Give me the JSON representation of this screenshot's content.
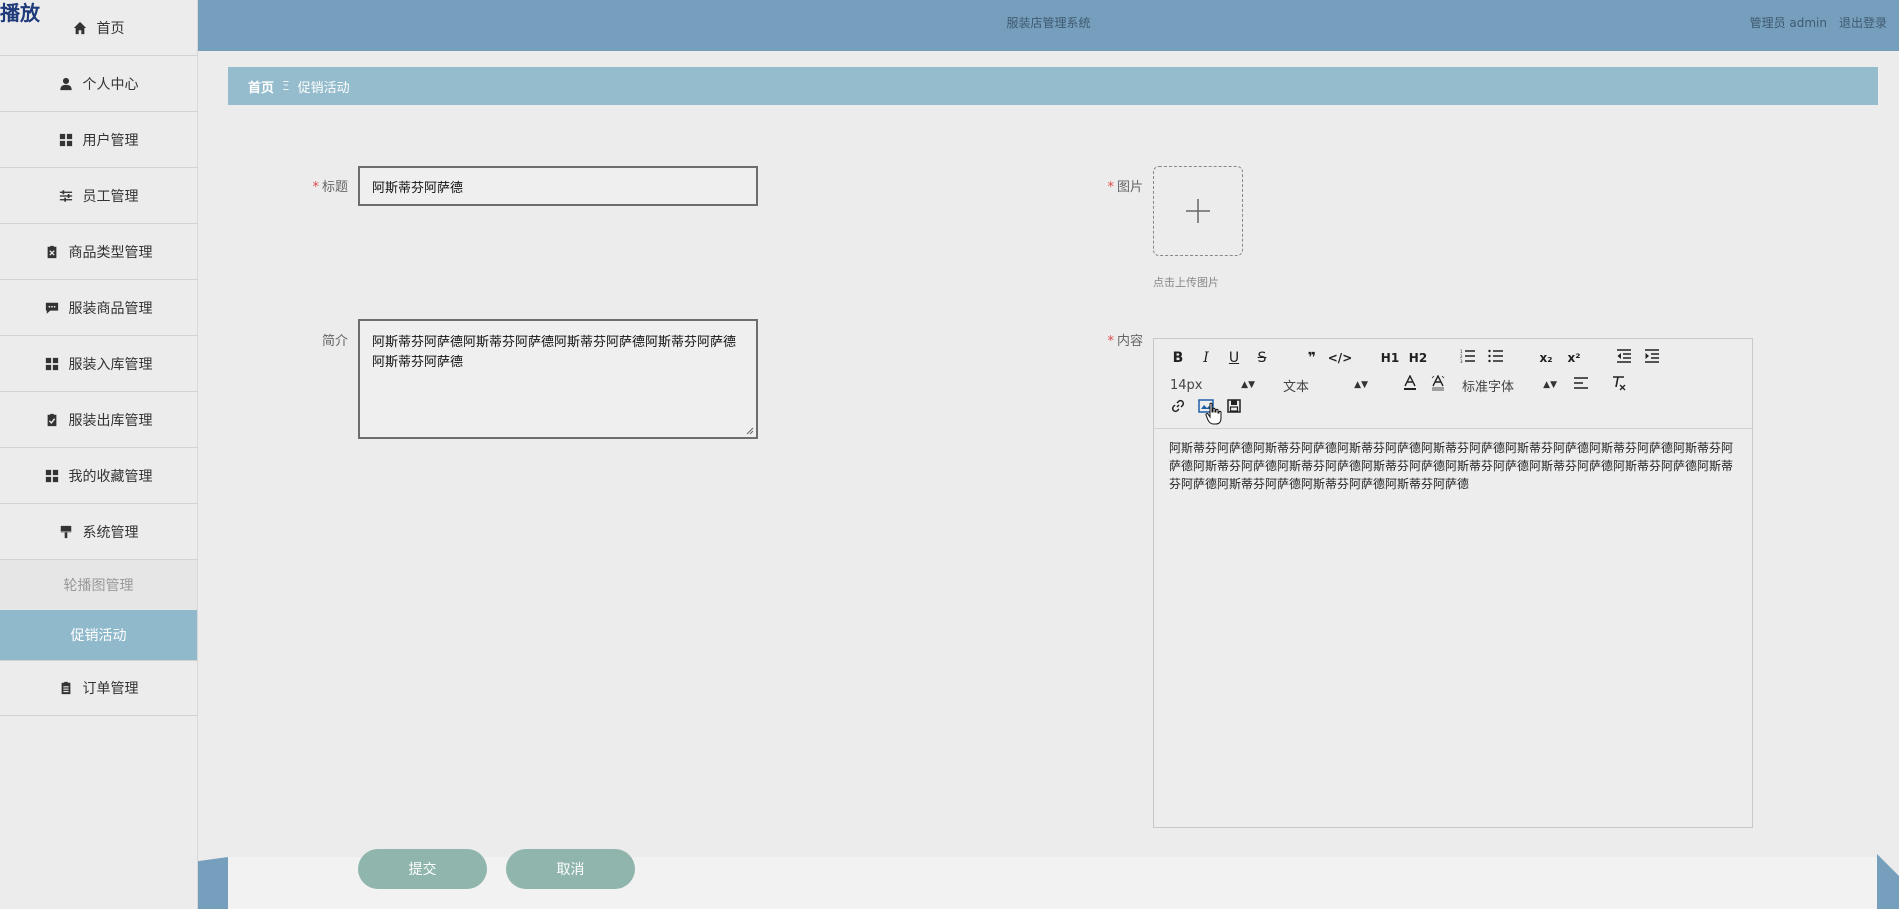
{
  "logo": "播放",
  "header": {
    "title": "服装店管理系统",
    "role_user": "管理员 admin",
    "logout": "退出登录"
  },
  "sidebar": {
    "items": [
      {
        "label": "首页",
        "icon": "home-icon"
      },
      {
        "label": "个人中心",
        "icon": "user-icon"
      },
      {
        "label": "用户管理",
        "icon": "grid-icon"
      },
      {
        "label": "员工管理",
        "icon": "sliders-icon"
      },
      {
        "label": "商品类型管理",
        "icon": "clipboard-x-icon"
      },
      {
        "label": "服装商品管理",
        "icon": "message-icon"
      },
      {
        "label": "服装入库管理",
        "icon": "grid-icon"
      },
      {
        "label": "服装出库管理",
        "icon": "clipboard-check-icon"
      },
      {
        "label": "我的收藏管理",
        "icon": "grid-icon"
      },
      {
        "label": "系统管理",
        "icon": "brush-icon"
      }
    ],
    "sub_items": [
      {
        "label": "轮播图管理"
      },
      {
        "label": "促销活动"
      }
    ],
    "after": [
      {
        "label": "订单管理",
        "icon": "clipboard-list-icon"
      }
    ]
  },
  "breadcrumb": {
    "home": "首页",
    "separator": "Ξ",
    "current": "促销活动"
  },
  "form": {
    "title_label": "标题",
    "title_value": "阿斯蒂芬阿萨德",
    "image_label": "图片",
    "upload_hint": "点击上传图片",
    "intro_label": "简介",
    "intro_value": "阿斯蒂芬阿萨德阿斯蒂芬阿萨德阿斯蒂芬阿萨德阿斯蒂芬阿萨德阿斯蒂芬阿萨德",
    "content_label": "内容",
    "required_mark": "*"
  },
  "editor": {
    "toolbar_row1": [
      "B",
      "I",
      "U",
      "S",
      "❞",
      "</>",
      "H1",
      "H2",
      "ol",
      "ul",
      "x₂",
      "x²",
      "outdent",
      "indent"
    ],
    "font_size": "14px",
    "format": "文本",
    "font_family": "标准字体",
    "content": "阿斯蒂芬阿萨德阿斯蒂芬阿萨德阿斯蒂芬阿萨德阿斯蒂芬阿萨德阿斯蒂芬阿萨德阿斯蒂芬阿萨德阿斯蒂芬阿萨德阿斯蒂芬阿萨德阿斯蒂芬阿萨德阿斯蒂芬阿萨德阿斯蒂芬阿萨德阿斯蒂芬阿萨德阿斯蒂芬阿萨德阿斯蒂芬阿萨德阿斯蒂芬阿萨德阿斯蒂芬阿萨德阿斯蒂芬阿萨德"
  },
  "buttons": {
    "submit": "提交",
    "cancel": "取消"
  },
  "colors": {
    "header": "#769fbd",
    "breadcrumb": "#94bccc",
    "active_sub": "#90b9cc",
    "button": "#8fb5ad",
    "required": "#e04a4a"
  }
}
